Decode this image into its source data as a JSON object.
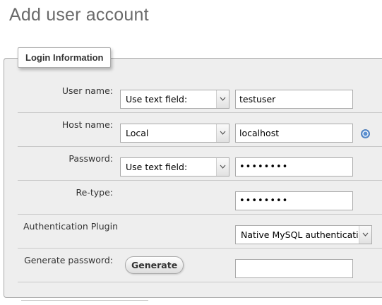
{
  "page": {
    "title": "Add user account"
  },
  "login_info": {
    "legend": "Login Information",
    "user_name": {
      "label": "User name:",
      "select": "Use text field:",
      "value": "testuser"
    },
    "host_name": {
      "label": "Host name:",
      "select": "Local",
      "value": "localhost"
    },
    "password": {
      "label": "Password:",
      "select": "Use text field:",
      "value": "••••••••"
    },
    "retype": {
      "label": "Re-type:",
      "value": "••••••••"
    },
    "auth_plugin": {
      "label": "Authentication Plugin",
      "select": "Native MySQL authentication"
    },
    "generate_password": {
      "label": "Generate password:",
      "button": "Generate",
      "value": ""
    }
  },
  "icons": {
    "help": "help-icon",
    "dropdown": "chevron-down-icon"
  },
  "colors": {
    "help_icon": "#5a8fd0",
    "panel_bg": "#eeeeee",
    "title": "#6a6a6a"
  }
}
